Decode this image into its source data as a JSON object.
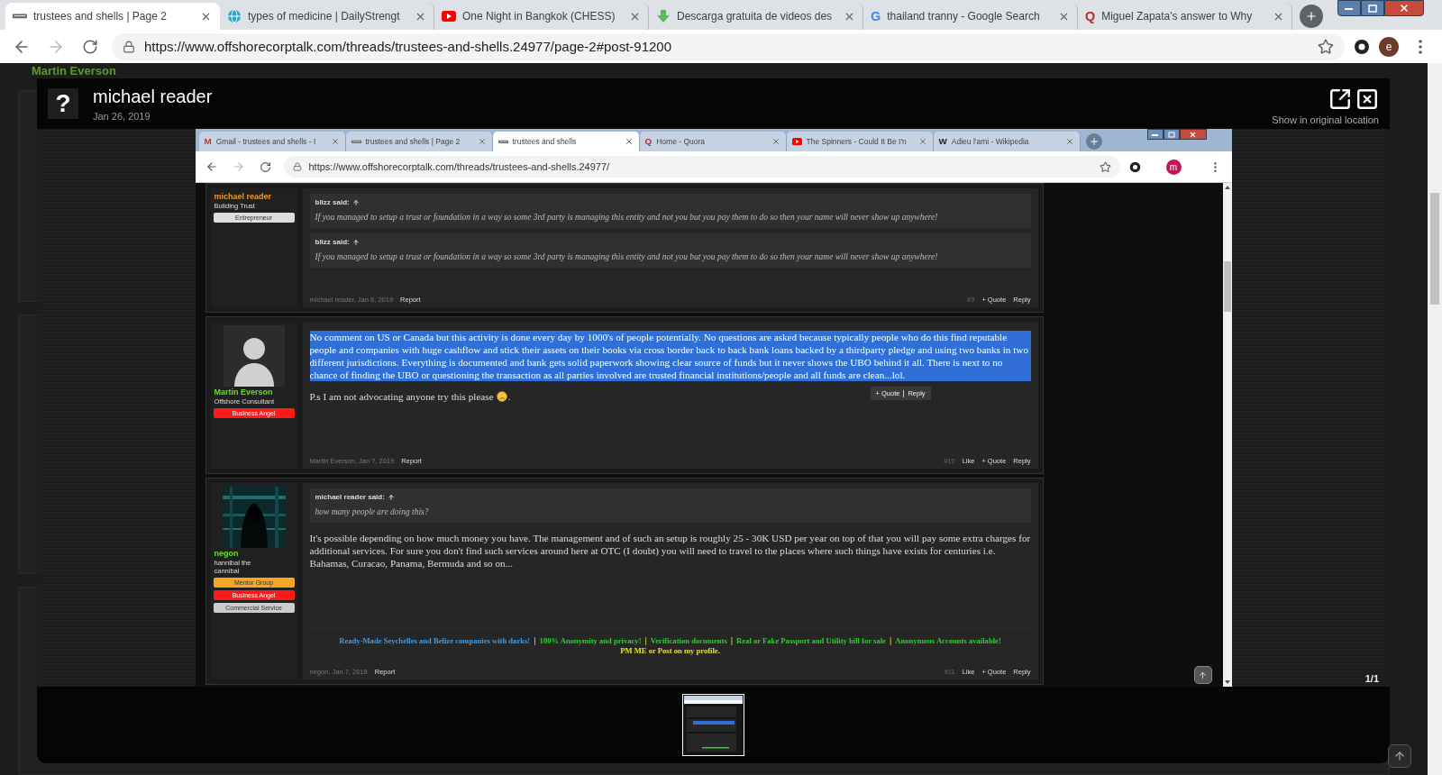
{
  "browser": {
    "tabs": [
      {
        "title": "trustees and shells | Page 2",
        "selected": true,
        "icon": {
          "kind": "forum"
        }
      },
      {
        "title": "types of medicine | DailyStrengt",
        "selected": false,
        "icon": {
          "kind": "globe"
        }
      },
      {
        "title": "One Night in Bangkok (CHESS)",
        "selected": false,
        "icon": {
          "kind": "video"
        }
      },
      {
        "title": "Descarga gratuita de videos des",
        "selected": false,
        "icon": {
          "kind": "download"
        }
      },
      {
        "title": "thailand tranny - Google Search",
        "selected": false,
        "icon": {
          "kind": "letter",
          "glyph": "G",
          "color": "#4285f4"
        }
      },
      {
        "title": "Miguel Zapata's answer to Why",
        "selected": false,
        "icon": {
          "kind": "letter",
          "glyph": "Q",
          "color": "#b92b27"
        }
      }
    ],
    "url": "https://www.offshorecorptalk.com/threads/trustees-and-shells.24977/page-2#post-91200",
    "profile_initial": "e"
  },
  "background": {
    "poster_name": "Martin Everson"
  },
  "lightbox": {
    "avatar_glyph": "?",
    "author": "michael reader",
    "date": "Jan 26, 2019",
    "original_link": "Show in original location",
    "counter": "1/1"
  },
  "screenshot": {
    "tabs": [
      {
        "title": "Gmail - trustees and shells - I",
        "selected": false,
        "icon": {
          "kind": "letter",
          "glyph": "M",
          "color": "#d93025"
        }
      },
      {
        "title": "trustees and shells | Page 2",
        "selected": false,
        "icon": {
          "kind": "forum"
        }
      },
      {
        "title": "trustees and shells",
        "selected": true,
        "icon": {
          "kind": "forum"
        }
      },
      {
        "title": "Home - Quora",
        "selected": false,
        "icon": {
          "kind": "letter",
          "glyph": "Q",
          "color": "#b92b27"
        }
      },
      {
        "title": "The Spinners - Could It Be I'n",
        "selected": false,
        "icon": {
          "kind": "video"
        }
      },
      {
        "title": "Adieu l'ami - Wikipedia",
        "selected": false,
        "icon": {
          "kind": "letter",
          "glyph": "W",
          "color": "#222222"
        }
      }
    ],
    "url": "https://www.offshorecorptalk.com/threads/trustees-and-shells.24977/",
    "profile_initial": "m",
    "posts": [
      {
        "user": {
          "name": "michael reader",
          "color": "#e89a2c",
          "title": "Building Trust",
          "badges": [
            {
              "label": "Entrepreneur",
              "color": "#dddddd"
            }
          ]
        },
        "quotes": [
          {
            "author": "blizz said:",
            "text": "If you managed to setup a trust or foundation in a way so some 3rd party is managing this entity and not you but you pay them to do so then your name will never show up anywhere!"
          },
          {
            "author": "blizz said:",
            "text": "If you managed to setup a trust or foundation in a way so some 3rd party is managing this entity and not you but you pay them to do so then your name will never show up anywhere!"
          }
        ],
        "footer": {
          "meta": "michael reader, Jan 6, 2019",
          "report": "Report",
          "number": "#9",
          "actions": [
            "+ Quote",
            "Reply"
          ]
        }
      },
      {
        "user": {
          "name": "Martin Everson",
          "color": "#66dd22",
          "title": "Offshore Consultant",
          "avatar": {
            "kind": "silhouette"
          },
          "badges": [
            {
              "label": "Business Angel",
              "color": "#ff1a1a"
            }
          ]
        },
        "paragraphs": [
          {
            "text": "No comment on US or Canada but this activity is done every day by 1000's of people potentially. No questions are asked because typically people who do this find reputable people and companies with huge cashflow and stick their assets on their books via cross border back to back bank loans backed by a thirdparty pledge and using two banks in two different jurisdictions. Everything is documented and bank gets solid paperwork showing clear source of funds but it never shows the UBO behind it all. There is next to no chance of finding the UBO or questioning the transaction as all parties involved are trusted financial institutions/people and all funds are clean...lol.",
            "selected": true
          },
          {
            "text": "P.s I am not advocating anyone try this please",
            "selected": false,
            "emoji": {
              "kind": "tired"
            },
            "trailing": "."
          }
        ],
        "popup": [
          "+ Quote",
          "Reply"
        ],
        "footer": {
          "meta": "Martin Everson, Jan 7, 2019",
          "report": "Report",
          "number": "#10",
          "actions": [
            "Like",
            "+ Quote",
            "Reply"
          ]
        }
      },
      {
        "user": {
          "name": "negon",
          "color": "#66dd22",
          "title": "hannibal the cannibal",
          "badges": [
            {
              "label": "Mentor Group",
              "color": "#f5a623"
            },
            {
              "label": "Business Angel",
              "color": "#ff1a1a"
            },
            {
              "label": "Commercial Service",
              "color": "#cccccc"
            }
          ]
        },
        "quotes": [
          {
            "author": "michael reader said:",
            "text": "how many people are doing this?"
          }
        ],
        "paragraphs": [
          {
            "text": "It's possible depending on how much money you have. The management and of such an setup is roughly 25 - 30K USD per year on top of that you will pay some extra charges for additional services. For sure you don't find such services around here at OTC (I doubt) you will need to travel to the places where such things have exists for centuries i.e. Bahamas, Curacao, Panama, Bermuda and so on...",
            "selected": false
          }
        ],
        "signature": [
          {
            "segments": [
              {
                "kind": "link",
                "text": "Ready-Made Seychelles and Belize companies with darks!",
                "color": "#3d9be9"
              },
              {
                "kind": "separator",
                "text": "|"
              },
              {
                "kind": "link",
                "text": "100% Anonymity and privacy!",
                "color": "#33cc33"
              },
              {
                "kind": "separator",
                "text": "|"
              },
              {
                "kind": "link",
                "text": "Verification documents",
                "color": "#33cc33"
              },
              {
                "kind": "separator",
                "text": "|"
              },
              {
                "kind": "link",
                "text": "Real or Fake Passport and Utility bill for sale",
                "color": "#33cc33"
              },
              {
                "kind": "separator",
                "text": "|"
              },
              {
                "kind": "link",
                "text": "Anonymous Accounts available!",
                "color": "#33cc33"
              }
            ]
          },
          {
            "segments": [
              {
                "kind": "link",
                "text": "PM ME or Post on my profile.",
                "color": "#e8e020"
              }
            ]
          }
        ],
        "footer": {
          "meta": "negon, Jan 7, 2019",
          "report": "Report",
          "number": "#11",
          "actions": [
            "Like",
            "+ Quote",
            "Reply"
          ]
        }
      }
    ]
  }
}
